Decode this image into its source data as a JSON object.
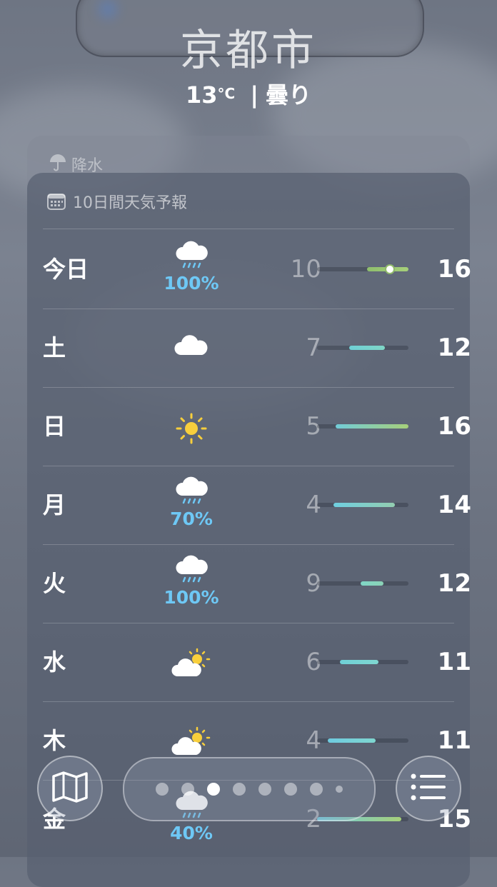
{
  "header": {
    "city": "京都市",
    "temp": "13",
    "temp_unit": "°C",
    "separator": "|",
    "condition": "曇り"
  },
  "precip_card": {
    "label": "降水",
    "icon": "umbrella-icon"
  },
  "forecast": {
    "title": "10日間天気予報",
    "icon": "calendar-icon",
    "days": [
      {
        "day": "今日",
        "icon": "rain-cloud-icon",
        "pct": "100%",
        "low": "10",
        "high": "16",
        "range": [
          0.55,
          1.0
        ],
        "current": 0.8,
        "colors": [
          "#8fbf6d",
          "#a6cf7a"
        ]
      },
      {
        "day": "土",
        "icon": "cloud-icon",
        "pct": "",
        "low": "7",
        "high": "12",
        "range": [
          0.35,
          0.74
        ],
        "colors": [
          "#6fd0d6",
          "#7fd6c6"
        ]
      },
      {
        "day": "日",
        "icon": "sun-icon",
        "pct": "",
        "low": "5",
        "high": "16",
        "range": [
          0.2,
          1.0
        ],
        "colors": [
          "#72ccd8",
          "#a6cf7a"
        ]
      },
      {
        "day": "月",
        "icon": "rain-cloud-icon",
        "pct": "70%",
        "low": "4",
        "high": "14",
        "range": [
          0.18,
          0.85
        ],
        "colors": [
          "#6fcfe0",
          "#93cdb0"
        ]
      },
      {
        "day": "火",
        "icon": "rain-cloud-icon",
        "pct": "100%",
        "low": "9",
        "high": "12",
        "range": [
          0.48,
          0.73
        ],
        "colors": [
          "#7fd6c6",
          "#8bd2b6"
        ]
      },
      {
        "day": "水",
        "icon": "partly-sunny-icon",
        "pct": "",
        "low": "6",
        "high": "11",
        "range": [
          0.25,
          0.67
        ],
        "colors": [
          "#6fd0d6",
          "#7fd6d0"
        ]
      },
      {
        "day": "木",
        "icon": "partly-sunny-icon",
        "pct": "",
        "low": "4",
        "high": "11",
        "range": [
          0.12,
          0.64
        ],
        "colors": [
          "#6ecbe0",
          "#7fd6d0"
        ]
      },
      {
        "day": "金",
        "icon": "rain-cloud-icon",
        "pct": "40%",
        "low": "2",
        "high": "15",
        "range": [
          0.0,
          0.92
        ],
        "colors": [
          "#6ecbe0",
          "#a6cf7a"
        ]
      }
    ]
  },
  "toolbar": {
    "map_icon": "map-icon",
    "list_icon": "list-icon",
    "page_count": 8,
    "current_page": 3
  }
}
